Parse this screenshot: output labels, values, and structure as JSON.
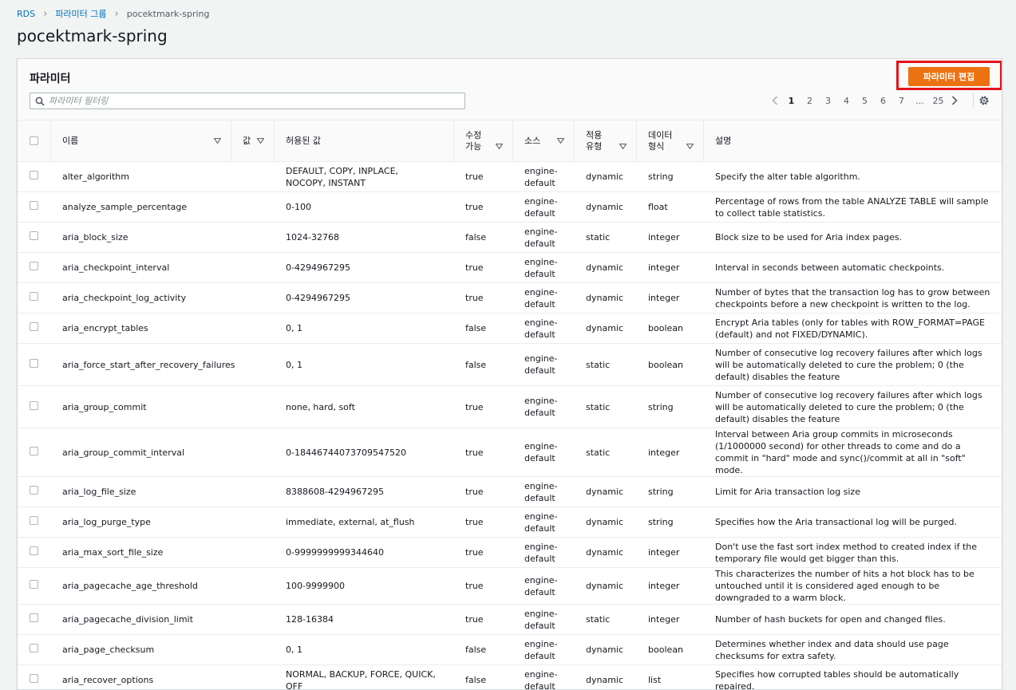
{
  "breadcrumb": {
    "root": "RDS",
    "parent": "파라미터 그룹",
    "current": "pocektmark-spring"
  },
  "page_title": "pocektmark-spring",
  "panel": {
    "title": "파라미터",
    "edit_button": "파라미터 편집",
    "search_placeholder": "파라미터 필터링",
    "pagination": {
      "pages": [
        "1",
        "2",
        "3",
        "4",
        "5",
        "6",
        "7",
        "...",
        "25"
      ],
      "current": "1"
    }
  },
  "columns": {
    "name": "이름",
    "value": "값",
    "allowed_values": "허용된 값",
    "modifiable_1": "수정",
    "modifiable_2": "가능",
    "source": "소스",
    "apply_type_1": "적용",
    "apply_type_2": "유형",
    "data_type_1": "데이터",
    "data_type_2": "형식",
    "description": "설명"
  },
  "rows": [
    {
      "name": "alter_algorithm",
      "allowed": "DEFAULT, COPY, INPLACE, NOCOPY, INSTANT",
      "modifiable": "true",
      "source": "engine-default",
      "apply": "dynamic",
      "dtype": "string",
      "desc": "Specify the alter table algorithm."
    },
    {
      "name": "analyze_sample_percentage",
      "allowed": "0-100",
      "modifiable": "true",
      "source": "engine-default",
      "apply": "dynamic",
      "dtype": "float",
      "desc": "Percentage of rows from the table ANALYZE TABLE will sample to collect table statistics."
    },
    {
      "name": "aria_block_size",
      "allowed": "1024-32768",
      "modifiable": "false",
      "source": "engine-default",
      "apply": "static",
      "dtype": "integer",
      "desc": "Block size to be used for Aria index pages."
    },
    {
      "name": "aria_checkpoint_interval",
      "allowed": "0-4294967295",
      "modifiable": "true",
      "source": "engine-default",
      "apply": "dynamic",
      "dtype": "integer",
      "desc": "Interval in seconds between automatic checkpoints."
    },
    {
      "name": "aria_checkpoint_log_activity",
      "allowed": "0-4294967295",
      "modifiable": "true",
      "source": "engine-default",
      "apply": "dynamic",
      "dtype": "integer",
      "desc": "Number of bytes that the transaction log has to grow between checkpoints before a new checkpoint is written to the log."
    },
    {
      "name": "aria_encrypt_tables",
      "allowed": "0, 1",
      "modifiable": "false",
      "source": "engine-default",
      "apply": "dynamic",
      "dtype": "boolean",
      "desc": "Encrypt Aria tables (only for tables with ROW_FORMAT=PAGE (default) and not FIXED/DYNAMIC)."
    },
    {
      "name": "aria_force_start_after_recovery_failures",
      "allowed": "0, 1",
      "modifiable": "false",
      "source": "engine-default",
      "apply": "static",
      "dtype": "boolean",
      "desc": "Number of consecutive log recovery failures after which logs will be automatically deleted to cure the problem; 0 (the default) disables the feature"
    },
    {
      "name": "aria_group_commit",
      "allowed": "none, hard, soft",
      "modifiable": "true",
      "source": "engine-default",
      "apply": "static",
      "dtype": "string",
      "desc": "Number of consecutive log recovery failures after which logs will be automatically deleted to cure the problem; 0 (the default) disables the feature"
    },
    {
      "name": "aria_group_commit_interval",
      "allowed": "0-18446744073709547520",
      "modifiable": "true",
      "source": "engine-default",
      "apply": "static",
      "dtype": "integer",
      "desc": "Interval between Aria group commits in microseconds (1/1000000 second) for other threads to come and do a commit in \"hard\" mode and sync()/commit at all in \"soft\" mode."
    },
    {
      "name": "aria_log_file_size",
      "allowed": "8388608-4294967295",
      "modifiable": "true",
      "source": "engine-default",
      "apply": "dynamic",
      "dtype": "string",
      "desc": "Limit for Aria transaction log size"
    },
    {
      "name": "aria_log_purge_type",
      "allowed": "immediate, external, at_flush",
      "modifiable": "true",
      "source": "engine-default",
      "apply": "dynamic",
      "dtype": "string",
      "desc": "Specifies how the Aria transactional log will be purged."
    },
    {
      "name": "aria_max_sort_file_size",
      "allowed": "0-9999999999344640",
      "modifiable": "true",
      "source": "engine-default",
      "apply": "dynamic",
      "dtype": "integer",
      "desc": "Don't use the fast sort index method to created index if the temporary file would get bigger than this."
    },
    {
      "name": "aria_pagecache_age_threshold",
      "allowed": "100-9999900",
      "modifiable": "true",
      "source": "engine-default",
      "apply": "dynamic",
      "dtype": "integer",
      "desc": "This characterizes the number of hits a hot block has to be untouched until it is considered aged enough to be downgraded to a warm block."
    },
    {
      "name": "aria_pagecache_division_limit",
      "allowed": "128-16384",
      "modifiable": "true",
      "source": "engine-default",
      "apply": "static",
      "dtype": "integer",
      "desc": "Number of hash buckets for open and changed files."
    },
    {
      "name": "aria_page_checksum",
      "allowed": "0, 1",
      "modifiable": "false",
      "source": "engine-default",
      "apply": "dynamic",
      "dtype": "boolean",
      "desc": "Determines whether index and data should use page checksums for extra safety."
    },
    {
      "name": "aria_recover_options",
      "allowed": "NORMAL, BACKUP, FORCE, QUICK, OFF",
      "modifiable": "false",
      "source": "engine-default",
      "apply": "dynamic",
      "dtype": "list",
      "desc": "Specifies how corrupted tables should be automatically repaired."
    }
  ],
  "colors": {
    "accent": "#ec7211",
    "link": "#0073bb",
    "highlight": "#e4121a"
  },
  "icons": {
    "search": "search-icon",
    "settings": "gear-icon",
    "sort": "sort-caret-icon",
    "prev": "chevron-left-icon",
    "next": "chevron-right-icon"
  }
}
